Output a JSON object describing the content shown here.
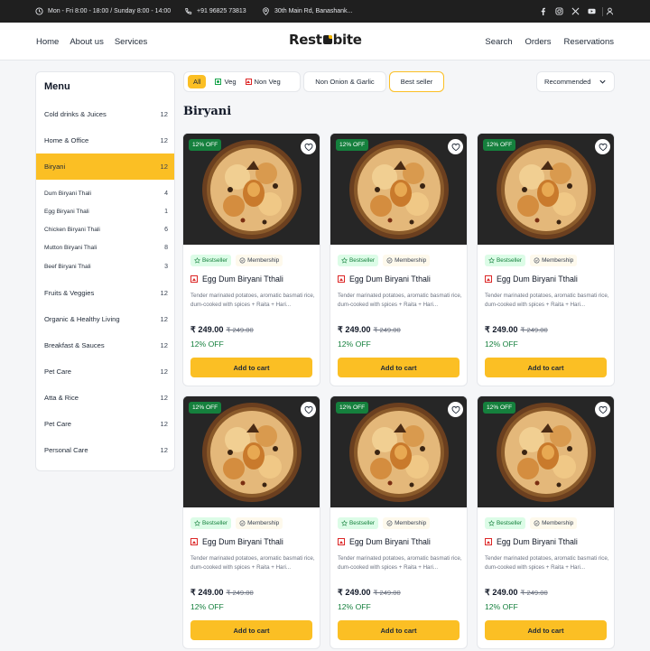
{
  "topbar": {
    "hours": "Mon - Fri 8:00 - 18:00 / Sunday 8:00 - 14:00",
    "phone": "+91 96825 73813",
    "address": "30th Main Rd, Banashank..."
  },
  "header": {
    "logo_left": "Rest",
    "logo_right": "bite",
    "nav_left": [
      "Home",
      "About us",
      "Services"
    ],
    "nav_right": [
      "Search",
      "Orders",
      "Reservations"
    ]
  },
  "sidebar": {
    "title": "Menu",
    "items": [
      {
        "label": "Cold drinks & Juices",
        "count": "12"
      },
      {
        "label": "Home & Office",
        "count": "12"
      },
      {
        "label": "Biryani",
        "count": "12"
      },
      {
        "label": "Dum Biryani Thali",
        "count": "4"
      },
      {
        "label": "Egg Biryani Thali",
        "count": "1"
      },
      {
        "label": "Chicken Biryani Thali",
        "count": "6"
      },
      {
        "label": "Mutton Biryani Thali",
        "count": "8"
      },
      {
        "label": "Beef Biryani Thali",
        "count": "3"
      },
      {
        "label": "Fruits & Veggies",
        "count": "12"
      },
      {
        "label": "Organic & Healthy Living",
        "count": "12"
      },
      {
        "label": "Breakfast & Sauces",
        "count": "12"
      },
      {
        "label": "Pet Care",
        "count": "12"
      },
      {
        "label": "Atta & Rice",
        "count": "12"
      },
      {
        "label": "Pet Care",
        "count": "12"
      },
      {
        "label": "Personal Care",
        "count": "12"
      }
    ]
  },
  "filters": {
    "all": "All",
    "veg": "Veg",
    "non_veg": "Non Veg",
    "non_onion": "Non Onion & Garlic",
    "best_seller": "Best seller",
    "sort": "Recommended"
  },
  "section_title": "Biryani",
  "card": {
    "discount_badge": "12% OFF",
    "tag_bestseller": "Bestseller",
    "tag_membership": "Membership",
    "name": "Egg Dum Biryani Tthali",
    "description": "Tender marinated potatoes, aromatic basmati rice, dum-cooked with spices + Raita + Hari...",
    "price": "₹ 249.00",
    "old_price": "₹ 249.00",
    "off": "12% OFF",
    "cart_label": "Add to cart"
  },
  "colors": {
    "accent": "#fbbf24",
    "green": "#15803d",
    "dark": "#1f1f1f"
  }
}
